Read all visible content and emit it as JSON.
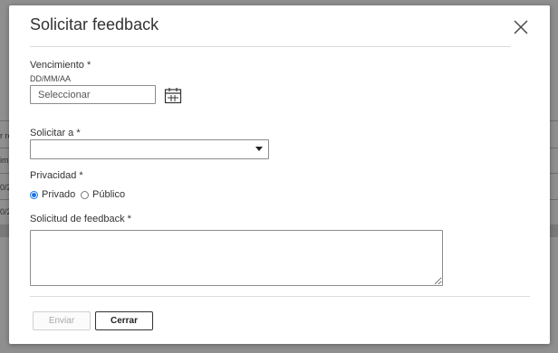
{
  "background": {
    "fragments": [
      "r re",
      "im",
      "0/2",
      "0/2"
    ]
  },
  "dialog": {
    "title": "Solicitar feedback",
    "due": {
      "label": "Vencimiento *",
      "format_hint": "DD/MM/AA",
      "placeholder": "Seleccionar",
      "value": ""
    },
    "request_to": {
      "label": "Solicitar a *",
      "selected": ""
    },
    "privacy": {
      "label": "Privacidad *",
      "options": [
        {
          "label": "Privado",
          "checked": true
        },
        {
          "label": "Público",
          "checked": false
        }
      ]
    },
    "request_text": {
      "label": "Solicitud de feedback *",
      "value": ""
    },
    "buttons": {
      "send_label": "Enviar",
      "send_disabled": true,
      "close_label": "Cerrar"
    }
  },
  "colors": {
    "overlay": "#8f8f8f",
    "radio_accent": "#1a73e8",
    "disabled_text": "#a8a8a8"
  },
  "icons": {
    "close": "close-icon",
    "calendar": "calendar-icon",
    "dropdown": "chevron-down-icon"
  }
}
